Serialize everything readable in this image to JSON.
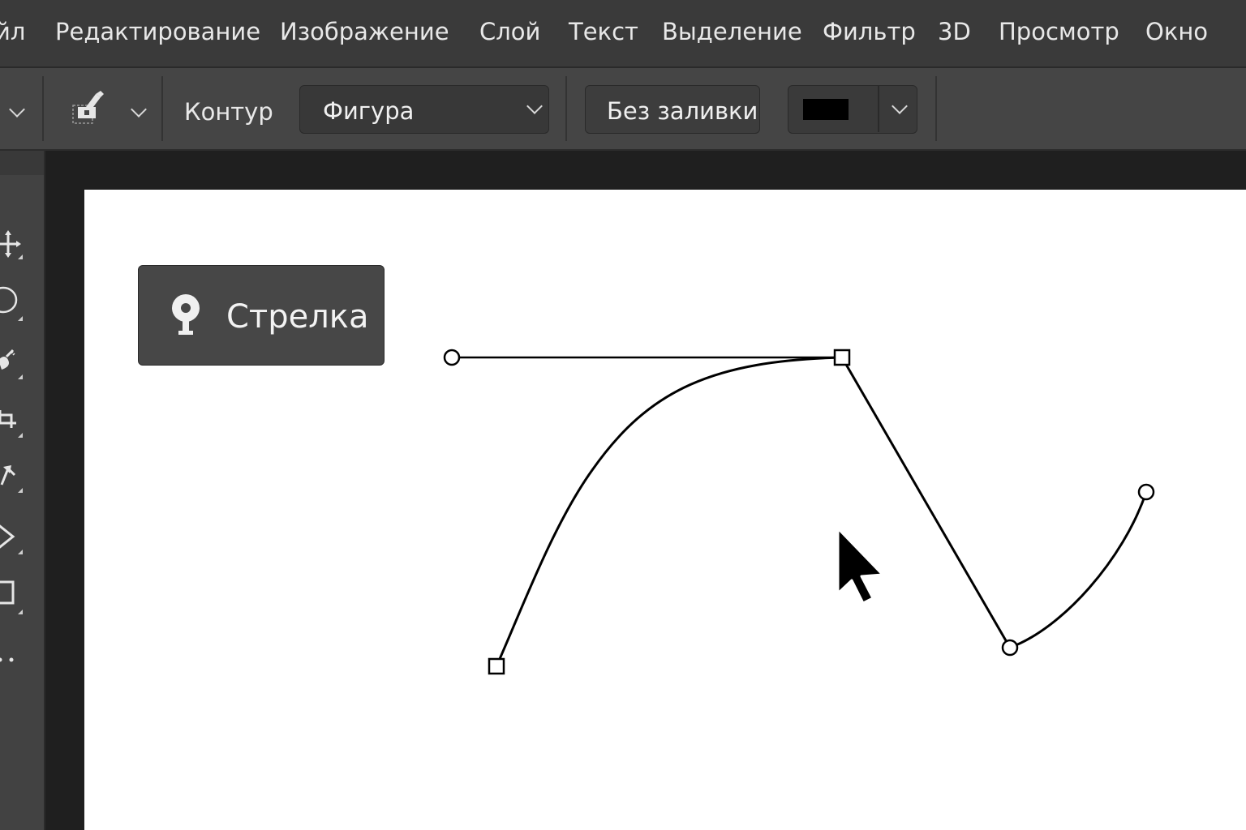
{
  "menubar": {
    "items": [
      {
        "label": "йл"
      },
      {
        "label": "Редактирование"
      },
      {
        "label": "Изображение"
      },
      {
        "label": "Слой"
      },
      {
        "label": "Текст"
      },
      {
        "label": "Выделение"
      },
      {
        "label": "Фильтр"
      },
      {
        "label": "3D"
      },
      {
        "label": "Просмотр"
      },
      {
        "label": "Окно"
      }
    ]
  },
  "options": {
    "mode_label": "Контур",
    "shape_select": {
      "value": "Фигура"
    },
    "fill_button": "Без заливки",
    "stroke_color": "#000000"
  },
  "toolbar": {
    "tools": [
      {
        "icon": "move-icon"
      },
      {
        "icon": "ellipse-select-icon"
      },
      {
        "icon": "brush-icon"
      },
      {
        "icon": "crop-icon"
      },
      {
        "icon": "path-select-icon"
      },
      {
        "icon": "pen-icon"
      },
      {
        "icon": "rectangle-icon"
      },
      {
        "icon": "more-icon"
      }
    ]
  },
  "tooltip": {
    "label": "Стрелка",
    "icon": "pin-icon"
  },
  "canvas": {
    "background": "#ffffff",
    "path_color": "#000000"
  }
}
